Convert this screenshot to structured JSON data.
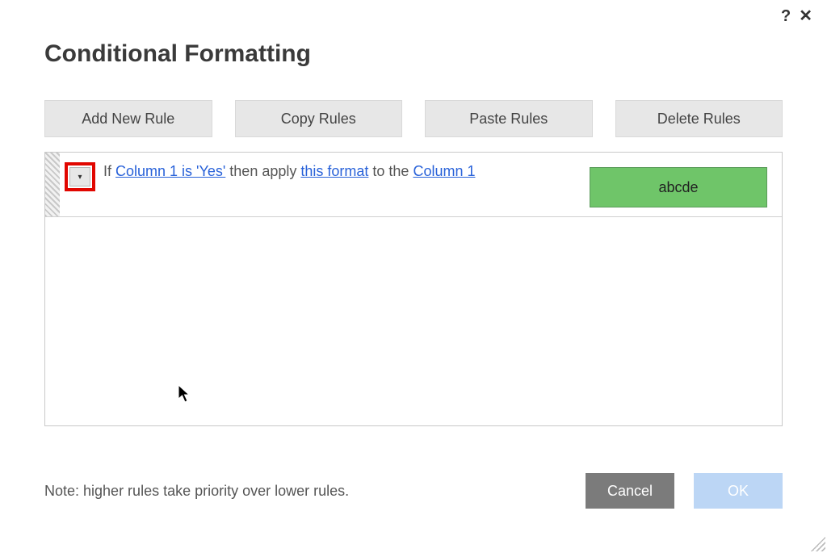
{
  "window": {
    "help_glyph": "?",
    "close_glyph": "✕"
  },
  "dialog": {
    "title": "Conditional Formatting"
  },
  "toolbar": {
    "add_label": "Add New Rule",
    "copy_label": "Copy Rules",
    "paste_label": "Paste Rules",
    "delete_label": "Delete Rules"
  },
  "rule": {
    "menu_glyph": "▾",
    "text_if": "If ",
    "condition_link": "Column 1 is 'Yes'",
    "text_then": " then apply ",
    "format_link": "this format",
    "text_to": " to the ",
    "target_link": "Column 1",
    "preview_text": "abcde",
    "preview_bg": "#6fc569",
    "preview_fg": "#222222"
  },
  "footer": {
    "note": "Note: higher rules take priority over lower rules.",
    "cancel_label": "Cancel",
    "ok_label": "OK"
  }
}
